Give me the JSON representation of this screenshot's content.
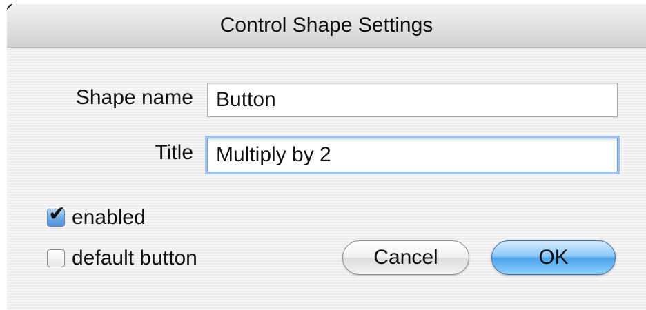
{
  "window": {
    "title": "Control Shape Settings"
  },
  "form": {
    "shape_name_label": "Shape name",
    "shape_name_value": "Button",
    "title_label": "Title",
    "title_value": "Multiply by 2"
  },
  "options": {
    "enabled_label": "enabled",
    "enabled_checked": true,
    "default_button_label": "default button",
    "default_button_checked": false
  },
  "buttons": {
    "cancel_label": "Cancel",
    "ok_label": "OK"
  },
  "colors": {
    "accent": "#4ea3ec",
    "focus_ring": "#9ec2ec"
  }
}
